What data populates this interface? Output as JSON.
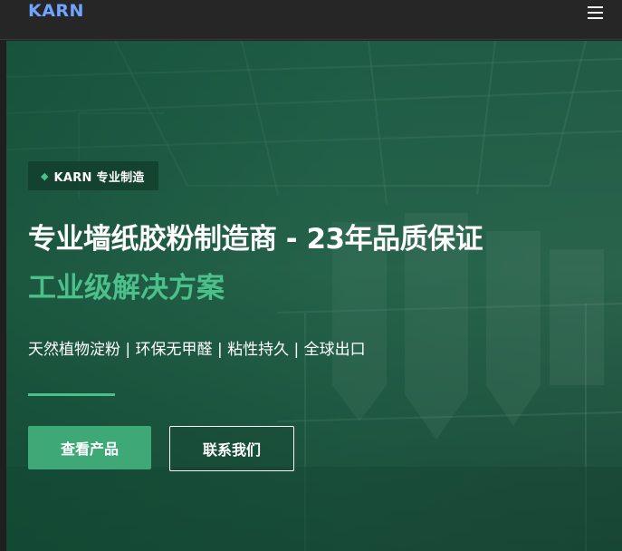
{
  "nav": {
    "logo": "KARN",
    "menu_icon": "hamburger-menu-icon"
  },
  "hero": {
    "badge_icon": "diamond-icon",
    "badge_text": "KARN 专业制造",
    "headline": "专业墙纸胶粉制造商 - 23年品质保证",
    "subheadline": "工业级解决方案",
    "features": "天然植物淀粉 | 环保无甲醛 | 粘性持久 | 全球出口",
    "primary_button": "查看产品",
    "secondary_button": "联系我们"
  },
  "colors": {
    "accent_green": "#4cc08a",
    "button_green": "#3ea877",
    "logo_blue": "#6fa4ff",
    "navbar_bg": "#262626"
  }
}
